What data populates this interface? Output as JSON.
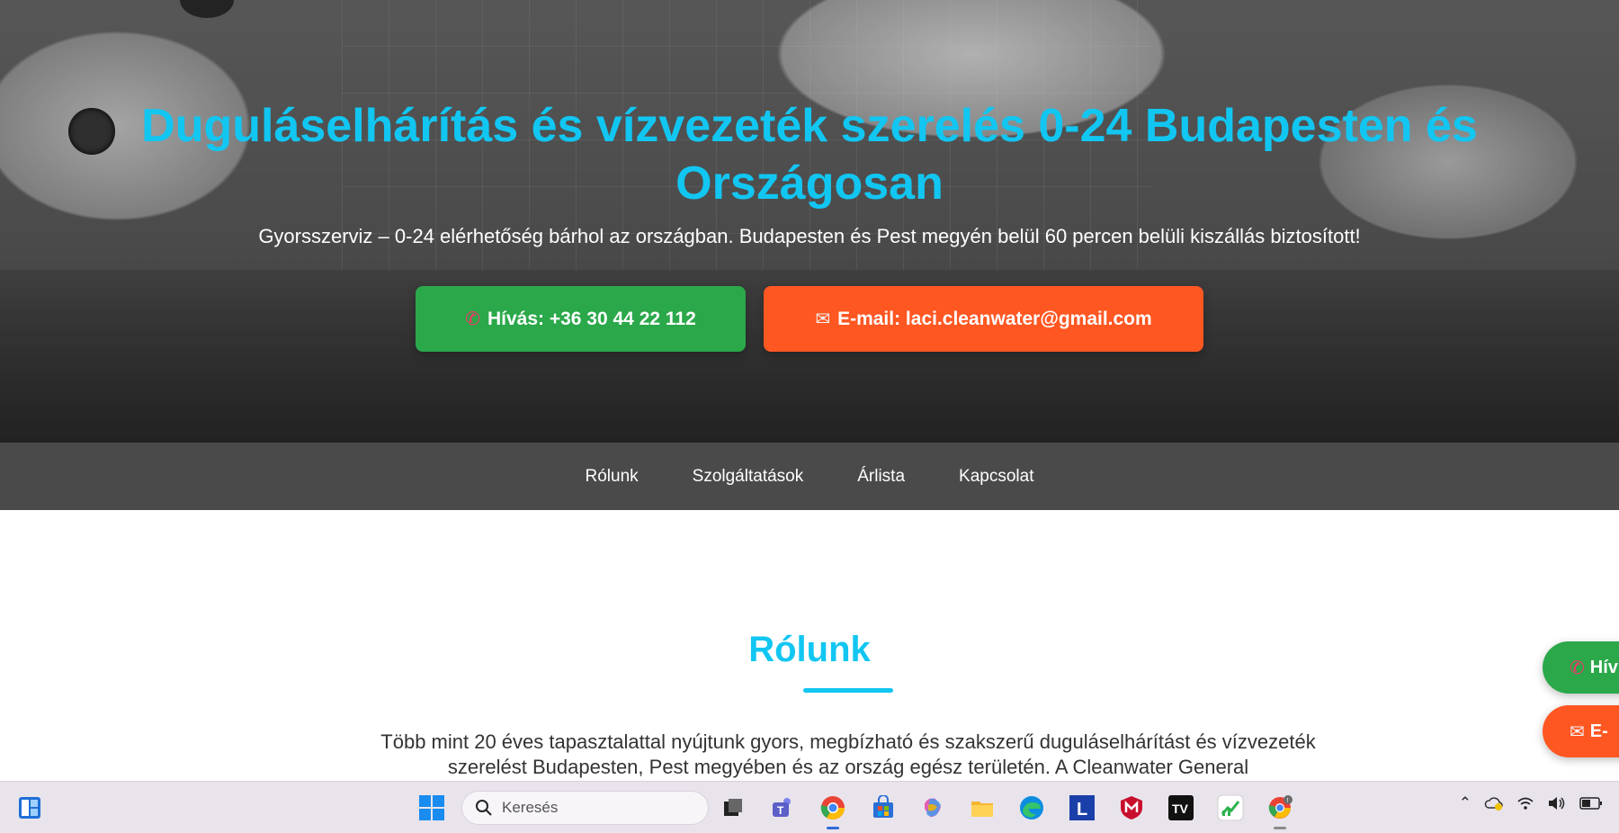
{
  "hero": {
    "title": "Duguláselhárítás és vízvezeték szerelés 0-24 Budapesten és Országosan",
    "subtitle": "Gyorsszerviz – 0-24 elérhetőség bárhol az országban. Budapesten és Pest megyén belül 60 percen belüli kiszállás biztosított!",
    "call_label": "Hívás: +36 30 44 22 112",
    "email_label": "E-mail: laci.cleanwater@gmail.com"
  },
  "nav": {
    "items": [
      "Rólunk",
      "Szolgáltatások",
      "Árlista",
      "Kapcsolat"
    ]
  },
  "about": {
    "title": "Rólunk",
    "text": "Több mint 20 éves tapasztalattal nyújtunk gyors, megbízható és szakszerű duguláselhárítást és vízvezeték szerelést Budapesten, Pest megyében és az ország egész területén. A Cleanwater General"
  },
  "floating": {
    "call_label": "Hív",
    "email_label": "E-"
  },
  "taskbar": {
    "search_placeholder": "Keresés",
    "apps": [
      "task-view",
      "teams",
      "chrome",
      "store",
      "copilot",
      "file-explorer",
      "edge",
      "l-app",
      "mcafee",
      "tradingview",
      "stocks-app",
      "chrome-notif"
    ]
  },
  "colors": {
    "accent": "#12c6f2",
    "call": "#2ba84a",
    "email": "#ff5722",
    "nav_bg": "#4a4a4a"
  }
}
